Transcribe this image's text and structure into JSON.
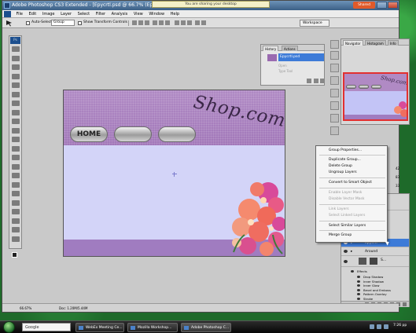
{
  "window": {
    "title": "Adobe Photoshop CS3 Extended - [Epycrtl.psd @ 66.7% (Epycrtl, RGB/8)]",
    "sharing_notice": "You are sharing your desktop",
    "shared_button": "Shared"
  },
  "menu": [
    "File",
    "Edit",
    "Image",
    "Layer",
    "Select",
    "Filter",
    "Analysis",
    "View",
    "Window",
    "Help"
  ],
  "options_bar": {
    "auto_select_label": "Auto-Select:",
    "auto_select_value": "Group",
    "show_transform_label": "Show Transform Controls",
    "workspace_label": "Workspace"
  },
  "tools": {
    "badge": "Ps",
    "icons": [
      "move-tool-icon",
      "marquee-tool-icon",
      "lasso-tool-icon",
      "quick-select-tool-icon",
      "crop-tool-icon",
      "eyedropper-tool-icon",
      "healing-tool-icon",
      "brush-tool-icon",
      "stamp-tool-icon",
      "history-brush-icon",
      "eraser-tool-icon",
      "gradient-tool-icon",
      "blur-tool-icon",
      "dodge-tool-icon",
      "pen-tool-icon",
      "type-tool-icon",
      "path-select-icon",
      "shape-tool-icon",
      "notes-tool-icon",
      "3d-tool-icon",
      "hand-tool-icon",
      "zoom-tool-icon"
    ]
  },
  "document": {
    "logo_text": "Shop.com",
    "home_button": "HOME"
  },
  "status": {
    "zoom": "66.67%",
    "doc_size": "Doc: 1.20M/5.44M"
  },
  "history_panel": {
    "tabs": [
      "History",
      "Actions"
    ],
    "selected_item": "Epycrtl.psd",
    "rows": [
      "Open",
      "Type Tool"
    ]
  },
  "navigator": {
    "tabs": [
      "Navigator",
      "Histogram",
      "Info"
    ],
    "thumb_logo": "Shop.com"
  },
  "layers": {
    "rows": [
      "Epycrtl",
      "Around",
      "S..."
    ],
    "effects_header": "Effects",
    "effects": [
      "Drop Shadow",
      "Inner Shadow",
      "Inner Glow",
      "Bevel and Emboss",
      "Pattern Overlay",
      "Stroke"
    ],
    "swatch_values": [
      "42",
      "83",
      "33"
    ]
  },
  "context_menu": {
    "items": [
      {
        "label": "Group Properties...",
        "disabled": false
      },
      {
        "label": "Duplicate Group...",
        "disabled": false
      },
      {
        "label": "Delete Group",
        "disabled": false
      },
      {
        "label": "Ungroup Layers",
        "disabled": false
      },
      {
        "label": "Convert to Smart Object",
        "disabled": false
      },
      {
        "label": "Enable Layer Mask",
        "disabled": true
      },
      {
        "label": "Disable Vector Mask",
        "disabled": true
      },
      {
        "label": "Link Layers",
        "disabled": true
      },
      {
        "label": "Select Linked Layers",
        "disabled": true
      },
      {
        "label": "Select Similar Layers",
        "disabled": false
      },
      {
        "label": "Merge Group",
        "disabled": false
      }
    ]
  },
  "taskbar": {
    "search": "Google",
    "buttons": [
      "WebEx Meeting Ce...",
      "Mozilla Workshop...",
      "Adobe Photoshop C..."
    ],
    "clock": "7:26 pp"
  },
  "colors": {
    "header_purple": "#b08ac4",
    "body_lavender": "#c3c4f6",
    "selection_blue": "#3d7bd8",
    "navigator_frame": "#e23030"
  }
}
